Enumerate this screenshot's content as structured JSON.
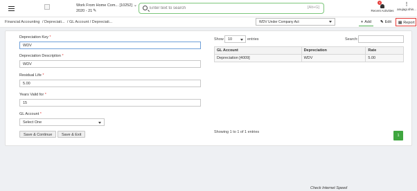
{
  "header": {
    "company_line1": "Work From Home Com... [10252]",
    "company_line2": "2020 - 21",
    "search_placeholder": "Enter text to search",
    "search_shortcut": "[Alt+G]",
    "notification_count": "4",
    "recent_label": "Recent Activities",
    "user_label": "anujagi.shin..."
  },
  "breadcrumb": [
    "Financial Accounting",
    "/ Depreciati...",
    "/ GL Account / Depreciati..."
  ],
  "toolbar": {
    "method_select": "WDV Under Company Act",
    "add_label": "Add",
    "edit_label": "Edit",
    "report_label": "Report"
  },
  "form": {
    "key_label": "Depreciation Key",
    "key_value": "WDV",
    "desc_label": "Depreciation Description",
    "desc_value": "WDV",
    "residual_label": "Residual Life",
    "residual_value": "5.00",
    "years_label": "Years Valid for",
    "years_value": "15",
    "gl_label": "GL Account",
    "gl_value": "Select One",
    "save_continue": "Save & Continue",
    "save_exit": "Save & Exit"
  },
  "table": {
    "show_label": "Show",
    "entries_value": "10",
    "entries_label": "entries",
    "search_label": "Search:",
    "columns": [
      "GL Account",
      "Depreciation",
      "Rate"
    ],
    "rows": [
      [
        "Depreciation [4009]",
        "WDV",
        "5.00"
      ]
    ],
    "info": "Showing 1 to 1 of 1 entries",
    "page": "1"
  },
  "footer_text": "Check Internet Speed",
  "colors": {
    "accent_green": "#3fa63f",
    "alert_red": "#e53935"
  }
}
